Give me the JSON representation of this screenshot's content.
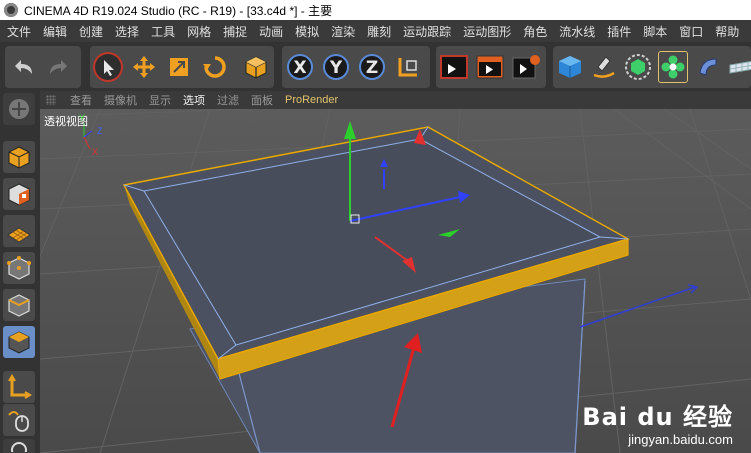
{
  "window": {
    "title": "CINEMA 4D R19.024 Studio (RC - R19) - [33.c4d *] - 主要"
  },
  "menu": {
    "items": [
      {
        "label": "文件"
      },
      {
        "label": "编辑"
      },
      {
        "label": "创建"
      },
      {
        "label": "选择"
      },
      {
        "label": "工具"
      },
      {
        "label": "网格"
      },
      {
        "label": "捕捉"
      },
      {
        "label": "动画"
      },
      {
        "label": "模拟"
      },
      {
        "label": "渲染"
      },
      {
        "label": "雕刻"
      },
      {
        "label": "运动跟踪"
      },
      {
        "label": "运动图形"
      },
      {
        "label": "角色"
      },
      {
        "label": "流水线"
      },
      {
        "label": "插件"
      },
      {
        "label": "脚本"
      },
      {
        "label": "窗口"
      },
      {
        "label": "帮助"
      }
    ]
  },
  "toolbar": {
    "axis_x": "X",
    "axis_y": "Y",
    "axis_z": "Z"
  },
  "viewport_menu": {
    "items": [
      {
        "label": "查看"
      },
      {
        "label": "摄像机"
      },
      {
        "label": "显示"
      },
      {
        "label": "选项",
        "active": true
      },
      {
        "label": "过滤"
      },
      {
        "label": "面板"
      },
      {
        "label": "ProRender",
        "pro": true
      }
    ]
  },
  "viewport": {
    "label": "透视视图",
    "axis_gizmo": {
      "y": "Y",
      "z": "Z",
      "x": "X"
    }
  },
  "watermark": {
    "logo": "Bai du 经验",
    "url": "jingyan.baidu.com"
  },
  "colors": {
    "selection_edge": "#e8a800",
    "viewport_bg": "#545454",
    "object_face": "#4a5160",
    "arrow_red": "#e02020"
  }
}
